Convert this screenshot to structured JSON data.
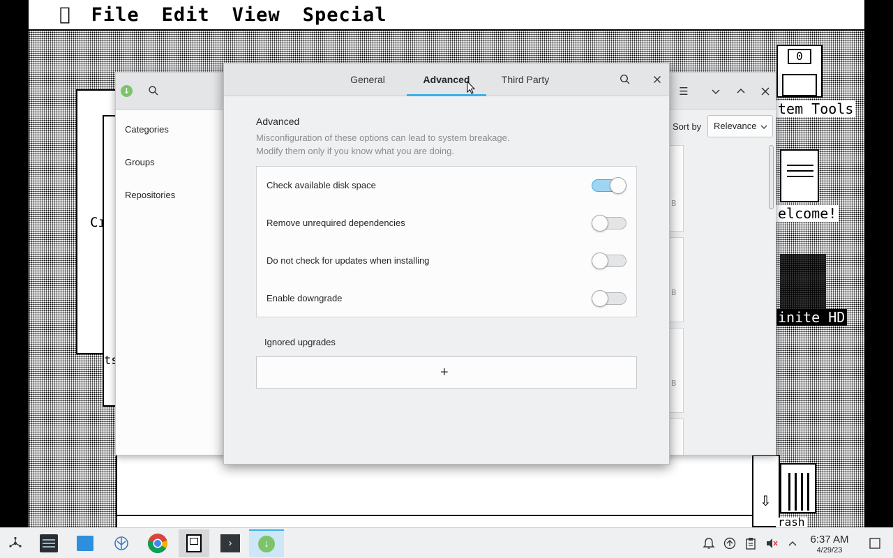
{
  "mac_desktop": {
    "menu": [
      "File",
      "Edit",
      "View",
      "Special"
    ],
    "icon_labels": [
      "tem Tools",
      "elcome!",
      "inite HD",
      "rash"
    ],
    "floppy_text": "0",
    "partial_texts": [
      "Cı",
      "ts"
    ]
  },
  "discover": {
    "sidebar": {
      "items": [
        "Categories",
        "Groups",
        "Repositories"
      ]
    },
    "sort_label": "Sort by",
    "sort_value": "Relevance",
    "card_suffix": "B"
  },
  "settings": {
    "tabs": [
      {
        "label": "General",
        "active": false
      },
      {
        "label": "Advanced",
        "active": true
      },
      {
        "label": "Third Party",
        "active": false
      }
    ],
    "section_title": "Advanced",
    "description_lines": [
      "Misconfiguration of these options can lead to system breakage.",
      "Modify them only if you know what you are doing."
    ],
    "options": [
      {
        "label": "Check available disk space",
        "enabled": true
      },
      {
        "label": "Remove unrequired dependencies",
        "enabled": false
      },
      {
        "label": "Do not check for updates when installing",
        "enabled": false
      },
      {
        "label": "Enable downgrade",
        "enabled": false
      }
    ],
    "ignored_title": "Ignored upgrades",
    "add_symbol": "+"
  },
  "taskbar": {
    "apps": [
      "app-launcher",
      "system-settings",
      "store",
      "discover-plasma",
      "chrome",
      "classic-mac",
      "terminal",
      "software-update"
    ],
    "active_app": "software-update",
    "clock": {
      "time": "6:37 AM",
      "date": "4/29/23"
    }
  },
  "colors": {
    "accent": "#3daee9",
    "toggle_on": "#9fd4f2",
    "window_bg": "#eff0f1"
  }
}
